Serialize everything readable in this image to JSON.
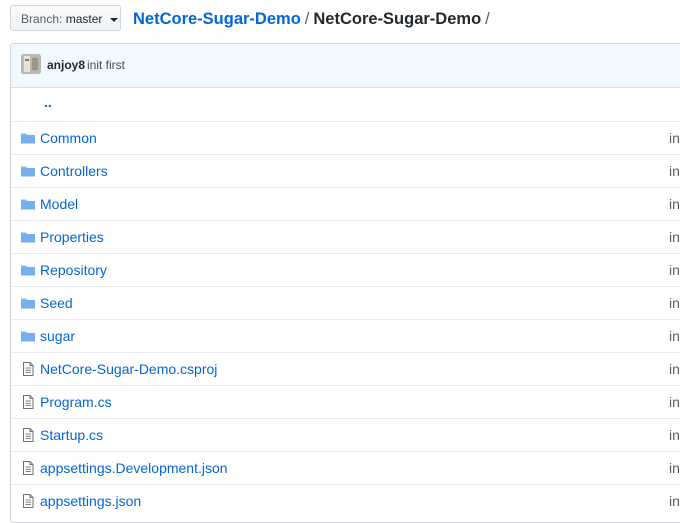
{
  "branch": {
    "label": "Branch:",
    "value": "master"
  },
  "breadcrumb": {
    "repo": "NetCore-Sugar-Demo",
    "separator": "/",
    "current": "NetCore-Sugar-Demo",
    "trailing": "/"
  },
  "commit": {
    "author": "anjoy8",
    "message": "init first"
  },
  "files": {
    "up_label": "..",
    "items": [
      {
        "name": "Common",
        "type": "folder",
        "commit": "in"
      },
      {
        "name": "Controllers",
        "type": "folder",
        "commit": "in"
      },
      {
        "name": "Model",
        "type": "folder",
        "commit": "in"
      },
      {
        "name": "Properties",
        "type": "folder",
        "commit": "in"
      },
      {
        "name": "Repository",
        "type": "folder",
        "commit": "in"
      },
      {
        "name": "Seed",
        "type": "folder",
        "commit": "in"
      },
      {
        "name": "sugar",
        "type": "folder",
        "commit": "in"
      },
      {
        "name": "NetCore-Sugar-Demo.csproj",
        "type": "file",
        "commit": "in"
      },
      {
        "name": "Program.cs",
        "type": "file",
        "commit": "in"
      },
      {
        "name": "Startup.cs",
        "type": "file",
        "commit": "in"
      },
      {
        "name": "appsettings.Development.json",
        "type": "file",
        "commit": "in"
      },
      {
        "name": "appsettings.json",
        "type": "file",
        "commit": "in"
      }
    ]
  },
  "colors": {
    "link": "#0366d6",
    "folder_icon": "#79b8ff",
    "file_icon": "#6a737d",
    "commit_bg": "#f1f8ff"
  }
}
